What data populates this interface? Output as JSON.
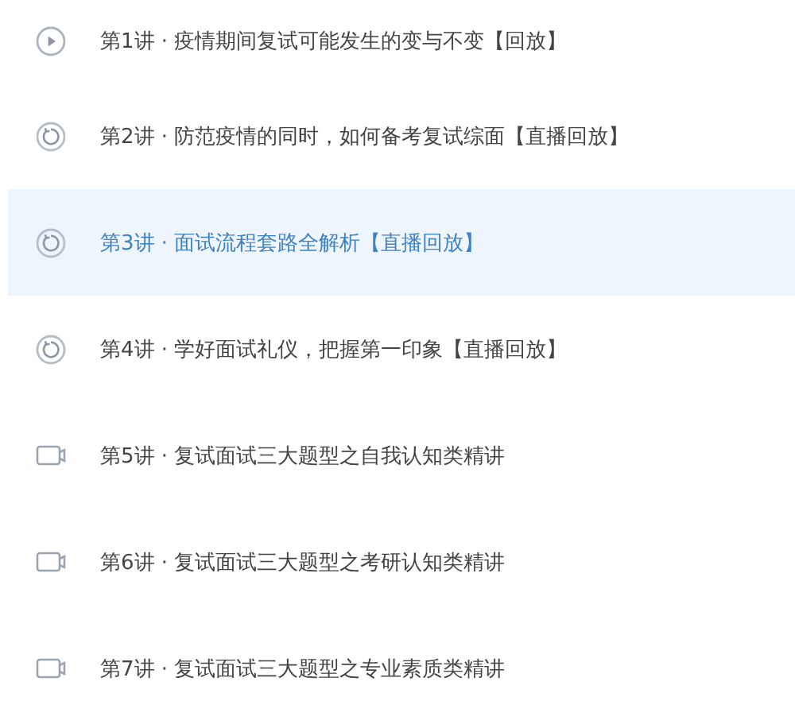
{
  "lessons": [
    {
      "kind": "play",
      "title": "第1讲 · 疫情期间复试可能发生的变与不变【回放】",
      "selected": false
    },
    {
      "kind": "replay",
      "title": "第2讲 · 防范疫情的同时，如何备考复试综面【直播回放】",
      "selected": false
    },
    {
      "kind": "replay",
      "title": "第3讲 · 面试流程套路全解析【直播回放】",
      "selected": true
    },
    {
      "kind": "replay",
      "title": "第4讲 · 学好面试礼仪，把握第一印象【直播回放】",
      "selected": false
    },
    {
      "kind": "video",
      "title": "第5讲 · 复试面试三大题型之自我认知类精讲",
      "selected": false
    },
    {
      "kind": "video",
      "title": "第6讲 · 复试面试三大题型之考研认知类精讲",
      "selected": false
    },
    {
      "kind": "video",
      "title": "第7讲 · 复试面试三大题型之专业素质类精讲",
      "selected": false
    }
  ]
}
